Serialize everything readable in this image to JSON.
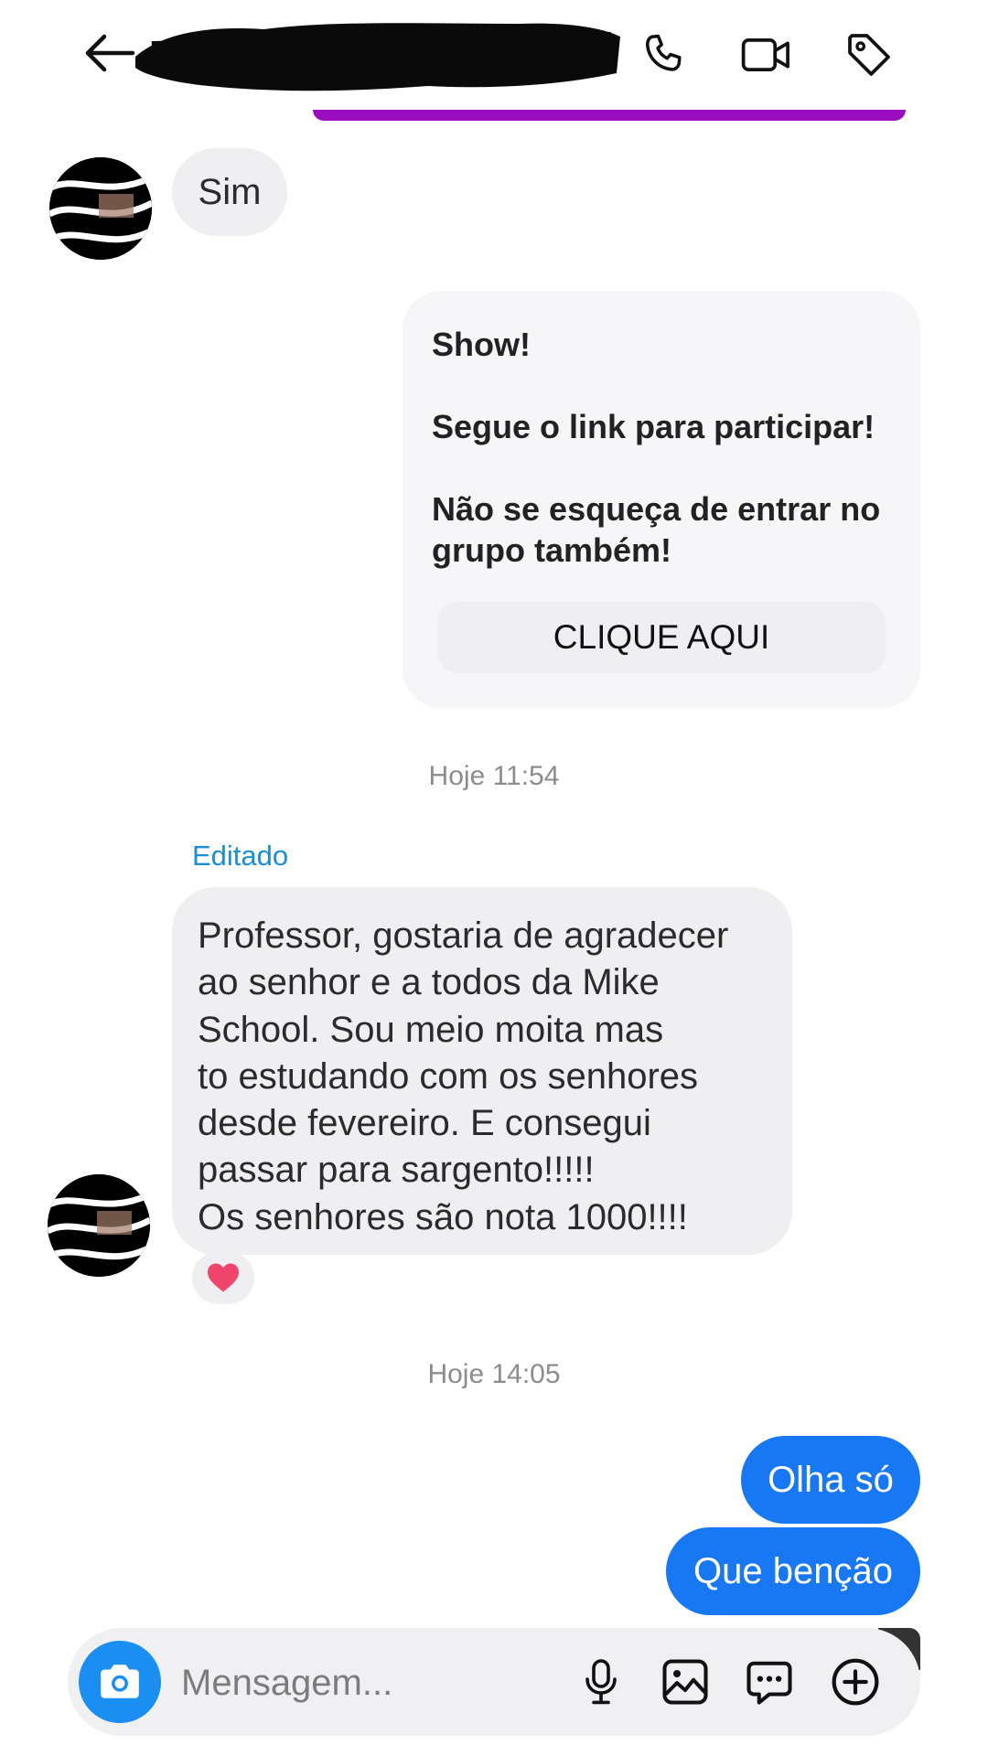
{
  "header": {
    "back_icon": "arrow-left-icon",
    "contact_name_redacted": true,
    "actions": [
      "phone-icon",
      "video-camera-icon",
      "tag-icon"
    ]
  },
  "messages": {
    "sim": "Sim",
    "card": {
      "line1": "Show!",
      "line2": "Segue o link para participar!",
      "line3": "Não se esqueça de entrar no grupo também!",
      "button_label": "CLIQUE AQUI"
    },
    "timestamp1": "Hoje 11:54",
    "edited_label": "Editado",
    "long_message": {
      "line1": "Professor, gostaria de agradecer",
      "line2": "ao senhor e a todos da Mike",
      "line3": "School. Sou meio moita mas",
      "line4": "to estudando com os senhores",
      "line5": "desde fevereiro. E consegui",
      "line6": "passar para sargento!!!!!",
      "line7": "Os senhores são nota 1000!!!!"
    },
    "reaction": "heart",
    "timestamp2": "Hoje 14:05",
    "out1": "Olha só",
    "out2": "Que benção"
  },
  "composer": {
    "placeholder": "Mensagem...",
    "icons": [
      "camera-icon",
      "microphone-icon",
      "image-icon",
      "sticker-chat-icon",
      "plus-circle-icon"
    ]
  },
  "colors": {
    "accent_blue": "#1877f2",
    "camera_blue": "#1b8ef2",
    "purple": "#9a0ebf",
    "incoming_bubble": "#efeff1",
    "edited_blue": "#1a8fd6"
  }
}
